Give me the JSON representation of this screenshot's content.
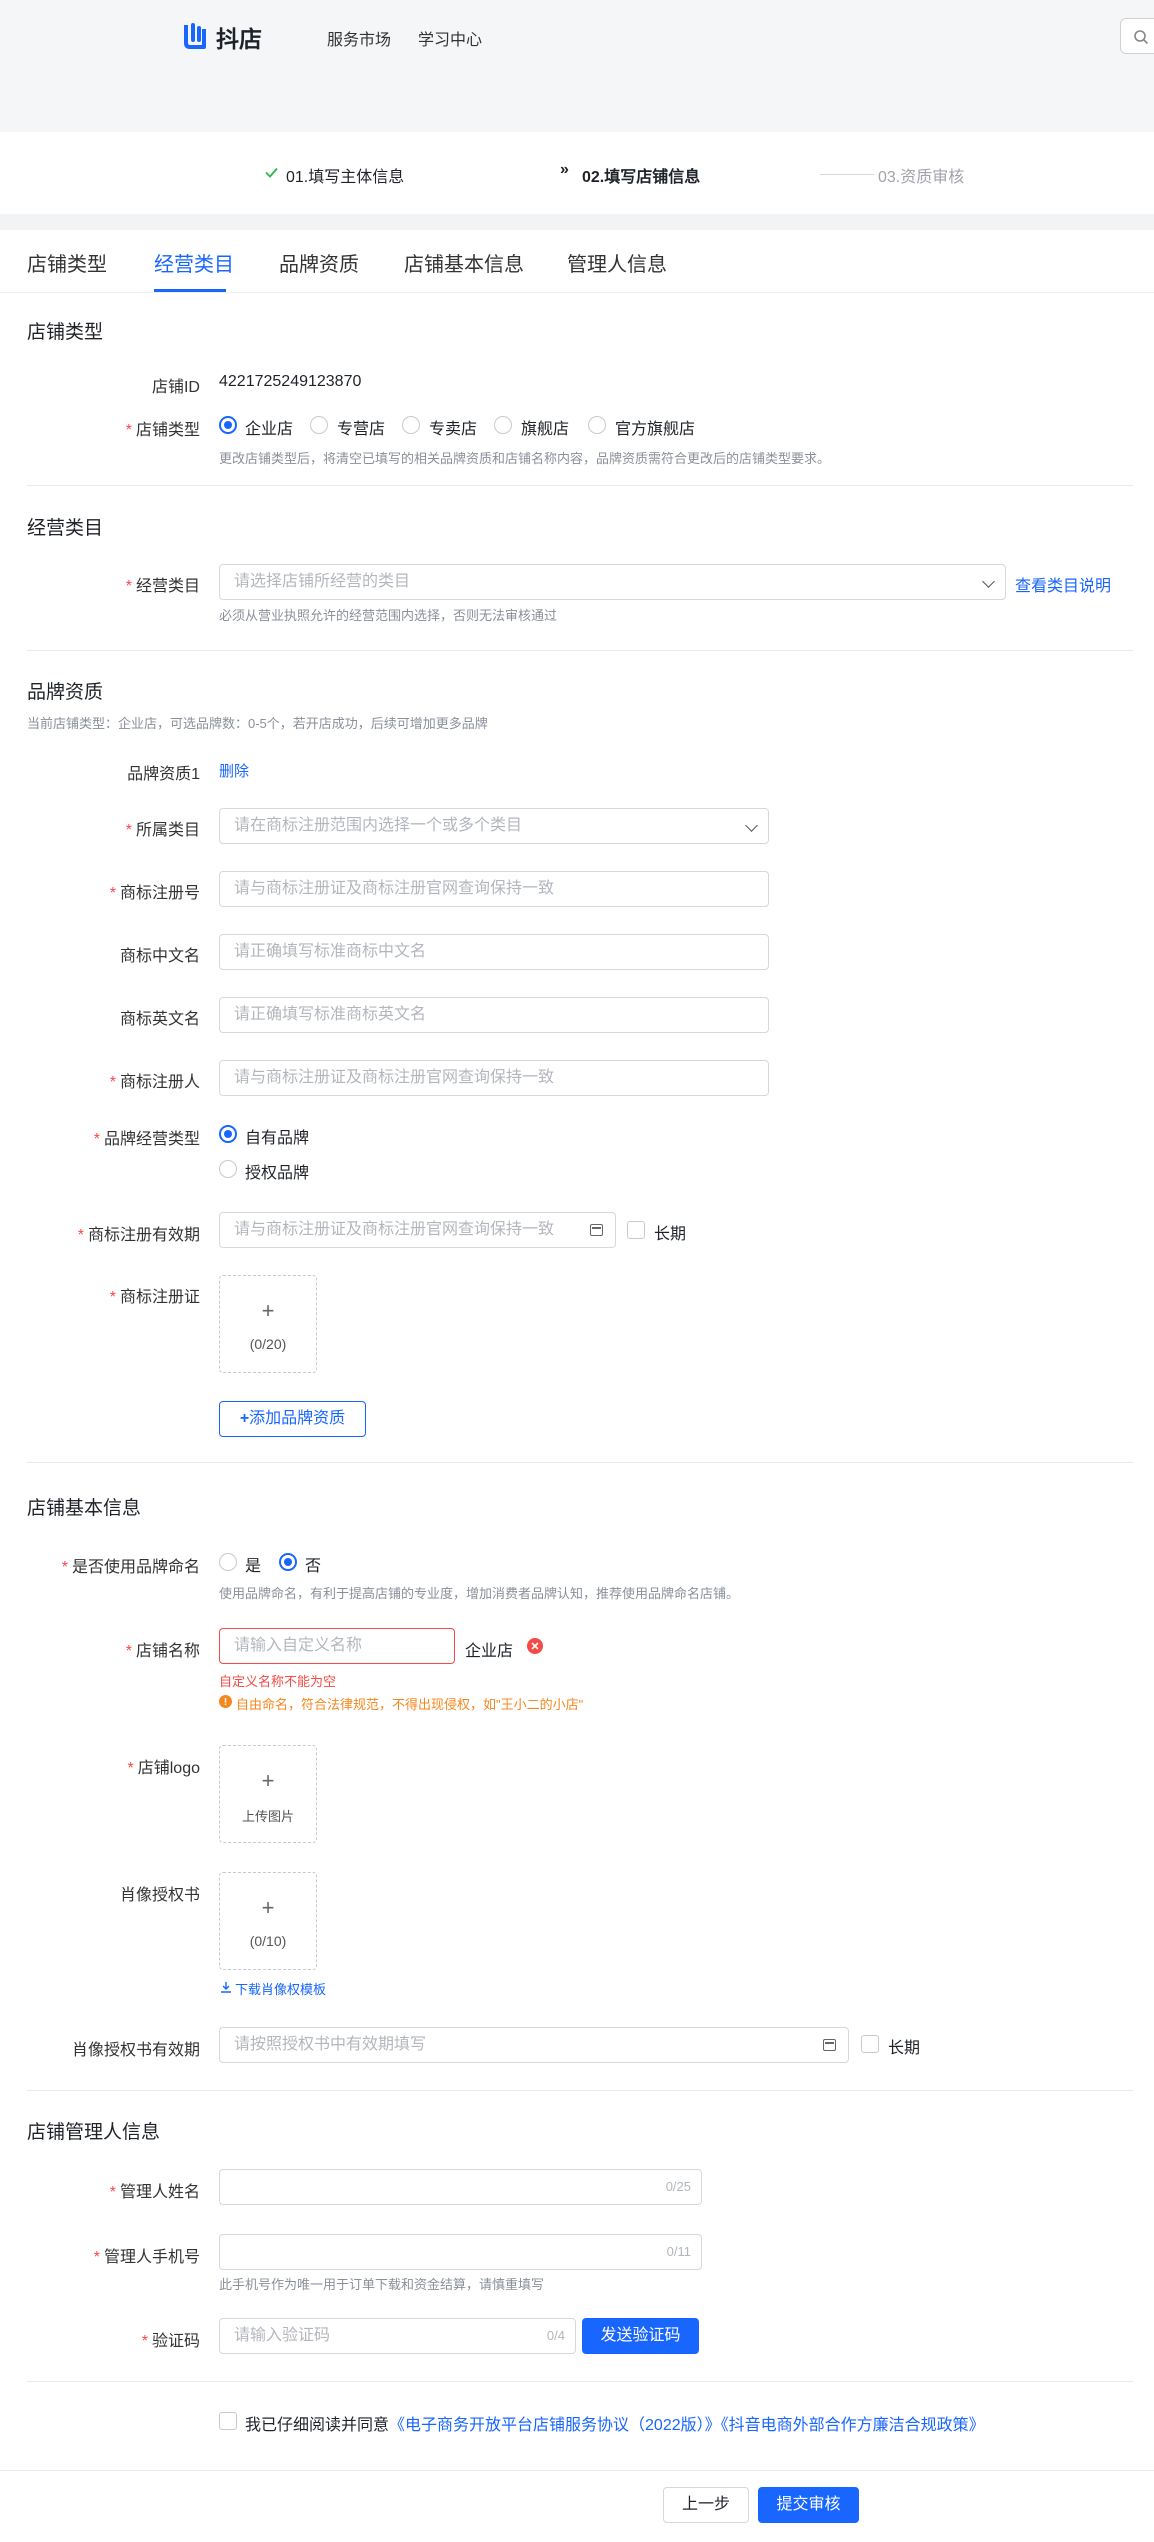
{
  "header": {
    "logo_text": "抖店",
    "nav": [
      "服务市场",
      "学习中心"
    ]
  },
  "steps": [
    {
      "label": "01.填写主体信息",
      "status": "done"
    },
    {
      "label": "02.填写店铺信息",
      "status": "current"
    },
    {
      "label": "03.资质审核",
      "status": "pending"
    }
  ],
  "tabs": [
    "店铺类型",
    "经营类目",
    "品牌资质",
    "店铺基本信息",
    "管理人信息"
  ],
  "active_tab": "经营类目",
  "shop_type": {
    "title": "店铺类型",
    "id_label": "店铺ID",
    "id_value": "4221725249123870",
    "type_label": "店铺类型",
    "options": [
      "企业店",
      "专营店",
      "专卖店",
      "旗舰店",
      "官方旗舰店"
    ],
    "selected": "企业店",
    "hint": "更改店铺类型后，将清空已填写的相关品牌资质和店铺名称内容，品牌资质需符合更改后的店铺类型要求。"
  },
  "category": {
    "title": "经营类目",
    "label": "经营类目",
    "placeholder": "请选择店铺所经营的类目",
    "link": "查看类目说明",
    "hint": "必须从营业执照允许的经营范围内选择，否则无法审核通过"
  },
  "brand": {
    "title": "品牌资质",
    "subtitle": "当前店铺类型：企业店，可选品牌数：0-5个，若开店成功，后续可增加更多品牌",
    "item_label": "品牌资质1",
    "delete": "删除",
    "fields": {
      "category_label": "所属类目",
      "category_placeholder": "请在商标注册范围内选择一个或多个类目",
      "reg_no_label": "商标注册号",
      "reg_no_placeholder": "请与商标注册证及商标注册官网查询保持一致",
      "cn_name_label": "商标中文名",
      "cn_name_placeholder": "请正确填写标准商标中文名",
      "en_name_label": "商标英文名",
      "en_name_placeholder": "请正确填写标准商标英文名",
      "owner_label": "商标注册人",
      "owner_placeholder": "请与商标注册证及商标注册官网查询保持一致",
      "brand_type_label": "品牌经营类型",
      "brand_type_options": [
        "自有品牌",
        "授权品牌"
      ],
      "brand_type_selected": "自有品牌",
      "validity_label": "商标注册有效期",
      "validity_placeholder": "请与商标注册证及商标注册官网查询保持一致",
      "long_term": "长期",
      "cert_label": "商标注册证",
      "cert_plus": "+",
      "cert_count": "(0/20)"
    },
    "add_button": "添加品牌资质",
    "add_plus": "+"
  },
  "shop_info": {
    "title": "店铺基本信息",
    "use_brand_label": "是否使用品牌命名",
    "use_brand_options": [
      "是",
      "否"
    ],
    "use_brand_selected": "否",
    "use_brand_hint": "使用品牌命名，有利于提高店铺的专业度，增加消费者品牌认知，推荐使用品牌命名店铺。",
    "name_label": "店铺名称",
    "name_placeholder": "请输入自定义名称",
    "name_suffix": "企业店",
    "name_error": "自定义名称不能为空",
    "name_warning": "自由命名，符合法律规范，不得出现侵权，如\"王小二的小店\"",
    "logo_label": "店铺logo",
    "logo_plus": "+",
    "logo_text": "上传图片",
    "portrait_label": "肖像授权书",
    "portrait_plus": "+",
    "portrait_count": "(0/10)",
    "portrait_download": "下载肖像权模板",
    "portrait_validity_label": "肖像授权书有效期",
    "portrait_validity_placeholder": "请按照授权书中有效期填写",
    "long_term": "长期"
  },
  "manager": {
    "title": "店铺管理人信息",
    "name_label": "管理人姓名",
    "name_counter": "0/25",
    "phone_label": "管理人手机号",
    "phone_counter": "0/11",
    "phone_hint": "此手机号作为唯一用于订单下载和资金结算，请慎重填写",
    "code_label": "验证码",
    "code_placeholder": "请输入验证码",
    "code_counter": "0/4",
    "send_code": "发送验证码"
  },
  "agreement": {
    "prefix": "我已仔细阅读并同意",
    "link1": "《电子商务开放平台店铺服务协议（2022版）》",
    "link2": "《抖音电商外部合作方廉洁合规政策》"
  },
  "footer": {
    "prev": "上一步",
    "submit": "提交审核"
  },
  "colors": {
    "primary": "#1966ff",
    "error": "#f54a45",
    "warning": "#f5871f",
    "success": "#33b44a"
  }
}
